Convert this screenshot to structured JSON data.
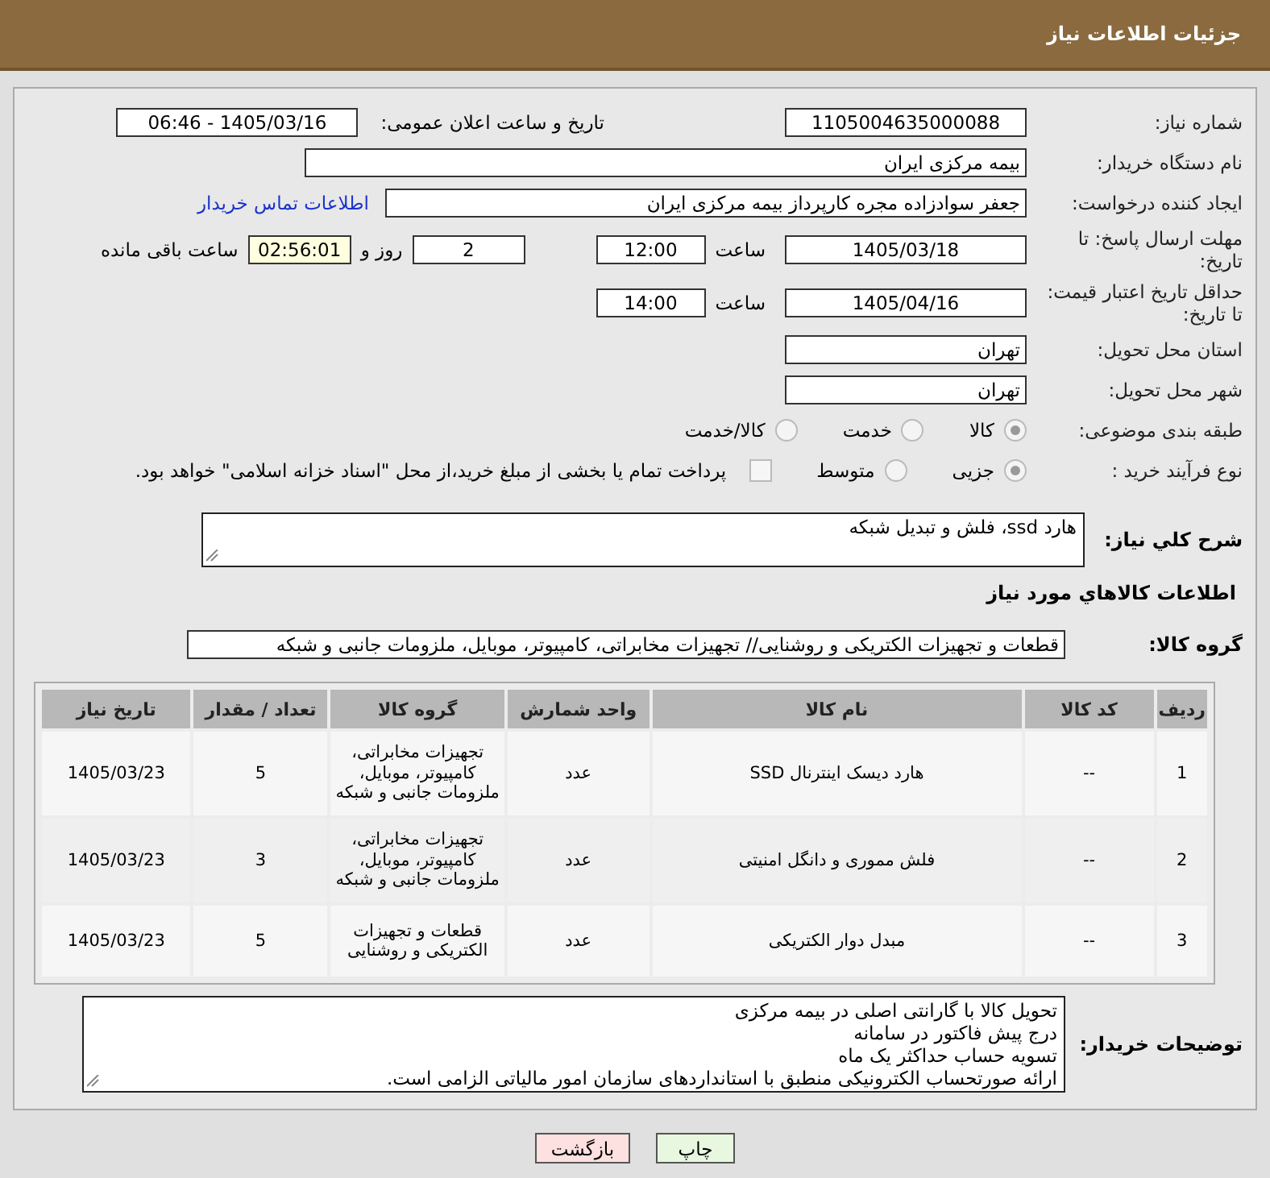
{
  "header_title": "جزئیات اطلاعات نیاز",
  "need_number": {
    "label": "شماره نیاز:",
    "value": "1105004635000088"
  },
  "announce": {
    "label": "تاریخ و ساعت اعلان عمومی:",
    "value": "1405/03/16 - 06:46"
  },
  "buyer_org": {
    "label": "نام دستگاه خریدار:",
    "value": "بیمه مرکزی ایران"
  },
  "requester": {
    "label": "ایجاد کننده درخواست:",
    "value": "جعفر سوادزاده مجره کارپرداز بیمه مرکزی ایران",
    "link": "اطلاعات تماس خریدار"
  },
  "deadline": {
    "label": "مهلت ارسال پاسخ: تا تاریخ:",
    "date": "1405/03/18",
    "time_label": "ساعت",
    "time": "12:00",
    "days": "2",
    "days_label": "روز و",
    "remaining": "02:56:01",
    "remaining_label": "ساعت باقی مانده"
  },
  "validity": {
    "label": "حداقل تاریخ اعتبار قیمت: تا تاریخ:",
    "date": "1405/04/16",
    "time_label": "ساعت",
    "time": "14:00"
  },
  "province": {
    "label": "استان محل تحویل:",
    "value": "تهران"
  },
  "city": {
    "label": "شهر محل تحویل:",
    "value": "تهران"
  },
  "category": {
    "label": "طبقه بندی موضوعی:",
    "options": [
      {
        "label": "کالا",
        "selected": true
      },
      {
        "label": "خدمت",
        "selected": false
      },
      {
        "label": "کالا/خدمت",
        "selected": false
      }
    ]
  },
  "process": {
    "label": "نوع فرآیند خرید :",
    "options": [
      {
        "label": "جزیی",
        "selected": true
      },
      {
        "label": "متوسط",
        "selected": false
      }
    ],
    "payment": {
      "label": "پرداخت تمام یا بخشی از مبلغ خرید،از محل \"اسناد خزانه اسلامی\" خواهد بود.",
      "checked": false
    }
  },
  "description": {
    "label": "شرح کلي نياز:",
    "value": "هارد ssd، فلش و تبدیل شبکه"
  },
  "goods_heading": "اطلاعات کالاهاي مورد نياز",
  "goods_group": {
    "label": "گروه کالا:",
    "value": "قطعات و تجهیزات الکتریکی و روشنایی// تجهیزات مخابراتی، کامپیوتر، موبایل، ملزومات جانبی و شبکه"
  },
  "table": {
    "columns": [
      "ردیف",
      "کد کالا",
      "نام کالا",
      "واحد شمارش",
      "گروه کالا",
      "تعداد / مقدار",
      "تاریخ نیاز"
    ],
    "rows": [
      [
        "1",
        "--",
        "هارد دیسک اینترنال SSD",
        "عدد",
        "تجهیزات مخابراتی، کامپیوتر، موبایل، ملزومات جانبی و شبکه",
        "5",
        "1405/03/23"
      ],
      [
        "2",
        "--",
        "فلش مموری و دانگل امنیتی",
        "عدد",
        "تجهیزات مخابراتی، کامپیوتر، موبایل، ملزومات جانبی و شبکه",
        "3",
        "1405/03/23"
      ],
      [
        "3",
        "--",
        "مبدل دوار الکتریکی",
        "عدد",
        "قطعات و تجهیزات الکتریکی و روشنایی",
        "5",
        "1405/03/23"
      ]
    ]
  },
  "buyer_notes": {
    "label": "توضیحات خریدار:",
    "lines": [
      "تحویل کالا با گارانتی اصلی در بیمه مرکزی",
      "درج پیش فاکتور در سامانه",
      "تسویه حساب حداکثر یک ماه",
      "ارائه صورتحساب الکترونیکی منطبق با استانداردهای سازمان امور مالیاتی الزامی است."
    ]
  },
  "buttons": [
    {
      "label": "چاپ",
      "kind": "print"
    },
    {
      "label": "بازگشت",
      "kind": "back"
    }
  ]
}
